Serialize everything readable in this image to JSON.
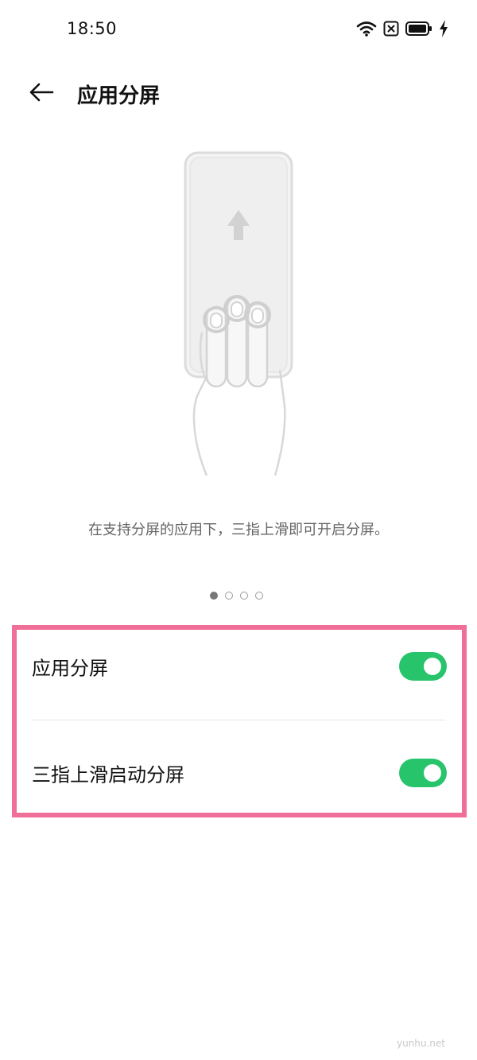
{
  "status_bar": {
    "time": "18:50",
    "icons": [
      "wifi-icon",
      "sim-error-icon",
      "battery-icon",
      "charging-bolt-icon"
    ]
  },
  "header": {
    "back_icon": "arrow-left-icon",
    "title": "应用分屏"
  },
  "tutorial": {
    "illustration": "three-finger-swipe-up-illustration",
    "description": "在支持分屏的应用下，三指上滑即可开启分屏。",
    "pages_total": 4,
    "current_page": 1
  },
  "settings": [
    {
      "label": "应用分屏",
      "enabled": true
    },
    {
      "label": "三指上滑启动分屏",
      "enabled": true
    }
  ],
  "colors": {
    "toggle_on": "#27c46c",
    "highlight_border": "#f06f98",
    "description_text": "#666666"
  },
  "watermark": "yunhu.net"
}
